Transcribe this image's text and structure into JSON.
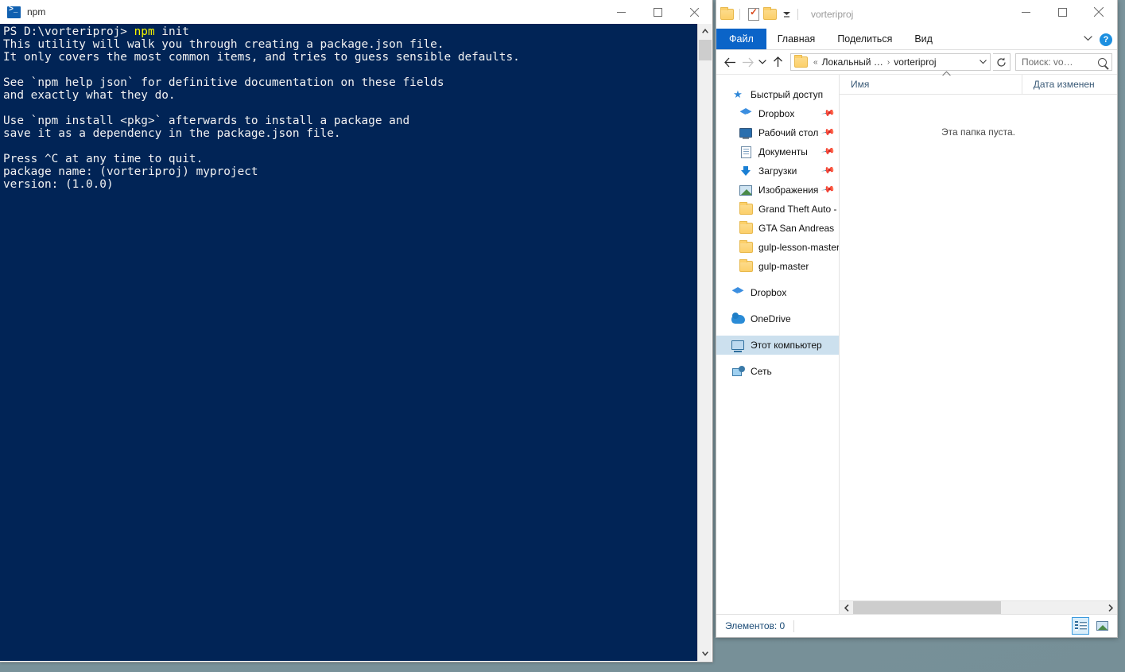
{
  "terminal": {
    "title": "npm",
    "icon": "powershell-icon",
    "background_color": "#012456",
    "prompt_keyword_color": "#f3f300",
    "lines": [
      {
        "type": "prompt",
        "prefix": "PS D:\\vorteriproj> ",
        "keyword": "npm",
        "rest": " init"
      },
      {
        "type": "text",
        "text": "This utility will walk you through creating a package.json file."
      },
      {
        "type": "text",
        "text": "It only covers the most common items, and tries to guess sensible defaults."
      },
      {
        "type": "blank",
        "text": ""
      },
      {
        "type": "text",
        "text": "See `npm help json` for definitive documentation on these fields"
      },
      {
        "type": "text",
        "text": "and exactly what they do."
      },
      {
        "type": "blank",
        "text": ""
      },
      {
        "type": "text",
        "text": "Use `npm install <pkg>` afterwards to install a package and"
      },
      {
        "type": "text",
        "text": "save it as a dependency in the package.json file."
      },
      {
        "type": "blank",
        "text": ""
      },
      {
        "type": "text",
        "text": "Press ^C at any time to quit."
      },
      {
        "type": "text",
        "text": "package name: (vorteriproj) myproject"
      },
      {
        "type": "text",
        "text": "version: (1.0.0)"
      }
    ],
    "window_controls": {
      "minimize": "—",
      "maximize": "□",
      "close": "✕"
    }
  },
  "explorer": {
    "title": "vorteriproj",
    "quick_access_toolbar": {
      "folder_icon": "folder-icon",
      "properties_icon": "properties-icon",
      "new_folder_icon": "new-folder-icon",
      "customize_caret": "⯆"
    },
    "window_controls": {
      "minimize": "—",
      "maximize": "□",
      "close": "✕"
    },
    "ribbon": {
      "tabs": [
        {
          "label": "Файл",
          "active": true
        },
        {
          "label": "Главная",
          "active": false
        },
        {
          "label": "Поделиться",
          "active": false
        },
        {
          "label": "Вид",
          "active": false
        }
      ],
      "collapse_caret": "⯆",
      "help_label": "?"
    },
    "address_bar": {
      "back": "←",
      "forward": "→",
      "recent_caret": "⯆",
      "up": "↑",
      "crumb_separator_first": "«",
      "crumbs": [
        "Локальный …",
        "vorteriproj"
      ],
      "crumb_separator": "›",
      "dropdown_caret": "⯆",
      "refresh": "↻"
    },
    "search": {
      "placeholder": "Поиск: vo…",
      "icon": "search-icon"
    },
    "nav_pane": {
      "groups": [
        {
          "items": [
            {
              "label": "Быстрый доступ",
              "icon": "star-icon",
              "pinned": false,
              "child": false,
              "selected": false
            },
            {
              "label": "Dropbox",
              "icon": "dropbox-icon",
              "pinned": true,
              "child": true,
              "selected": false
            },
            {
              "label": "Рабочий стол",
              "icon": "desktop-icon",
              "pinned": true,
              "child": true,
              "selected": false
            },
            {
              "label": "Документы",
              "icon": "documents-icon",
              "pinned": true,
              "child": true,
              "selected": false
            },
            {
              "label": "Загрузки",
              "icon": "downloads-icon",
              "pinned": true,
              "child": true,
              "selected": false
            },
            {
              "label": "Изображения",
              "icon": "pictures-icon",
              "pinned": true,
              "child": true,
              "selected": false
            },
            {
              "label": "Grand Theft Auto -",
              "icon": "folder-icon",
              "pinned": false,
              "child": true,
              "selected": false
            },
            {
              "label": "GTA San Andreas",
              "icon": "folder-icon",
              "pinned": false,
              "child": true,
              "selected": false
            },
            {
              "label": "gulp-lesson-master",
              "icon": "folder-icon",
              "pinned": false,
              "child": true,
              "selected": false
            },
            {
              "label": "gulp-master",
              "icon": "folder-icon",
              "pinned": false,
              "child": true,
              "selected": false
            }
          ]
        },
        {
          "items": [
            {
              "label": "Dropbox",
              "icon": "dropbox-icon",
              "pinned": false,
              "child": false,
              "selected": false
            }
          ]
        },
        {
          "items": [
            {
              "label": "OneDrive",
              "icon": "onedrive-icon",
              "pinned": false,
              "child": false,
              "selected": false
            }
          ]
        },
        {
          "items": [
            {
              "label": "Этот компьютер",
              "icon": "this-pc-icon",
              "pinned": false,
              "child": false,
              "selected": true
            }
          ]
        },
        {
          "items": [
            {
              "label": "Сеть",
              "icon": "network-icon",
              "pinned": false,
              "child": false,
              "selected": false
            }
          ]
        }
      ]
    },
    "file_list": {
      "columns": [
        {
          "label": "Имя",
          "sorted": true,
          "sort_caret": "ⱏ"
        },
        {
          "label": "Дата изменен",
          "sorted": false
        }
      ],
      "rows": [],
      "empty_message": "Эта папка пуста.",
      "hscroll_left": "‹",
      "hscroll_right": "›"
    },
    "status_bar": {
      "item_count_text": "Элементов: 0",
      "view_buttons": [
        {
          "name": "details-view-button",
          "active": true
        },
        {
          "name": "thumbnail-view-button",
          "active": false
        }
      ]
    }
  },
  "desktop": {
    "background_color": "#7b949c"
  }
}
